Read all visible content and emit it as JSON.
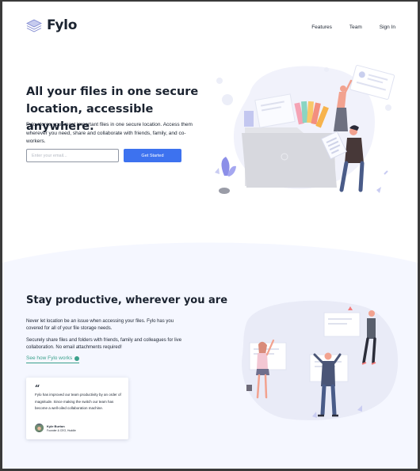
{
  "brand": {
    "name": "Fylo"
  },
  "nav": {
    "items": [
      {
        "label": "Features"
      },
      {
        "label": "Team"
      },
      {
        "label": "Sign In"
      }
    ]
  },
  "hero": {
    "title": "All your files in one secure location, accessible anywhere.",
    "description": "Fylo stores your most important files in one secure location. Access them wherever you need, share and collaborate with friends, family, and co-workers.",
    "email_placeholder": "Enter your email...",
    "cta_label": "Get Started"
  },
  "productive": {
    "title": "Stay productive, wherever you are",
    "paragraph1": "Never let location be an issue when accessing your files. Fylo has you covered for all of your file storage needs.",
    "paragraph2": "Securely share files and folders with friends, family and colleagues for live collaboration. No email attachments required!",
    "link_label": "See how Fylo works"
  },
  "testimonial": {
    "quote_mark": "“",
    "text": "Fylo has improved our team productivity by an order of magnitude. Since making the switch our team has become a well-oiled collaboration machine.",
    "author": "Kyle Burton",
    "role": "Founder & CEO, Huddle"
  },
  "colors": {
    "accent": "#3d72ef",
    "link": "#3ba18c",
    "section_bg": "#f5f7ff",
    "text": "#1b2330"
  }
}
